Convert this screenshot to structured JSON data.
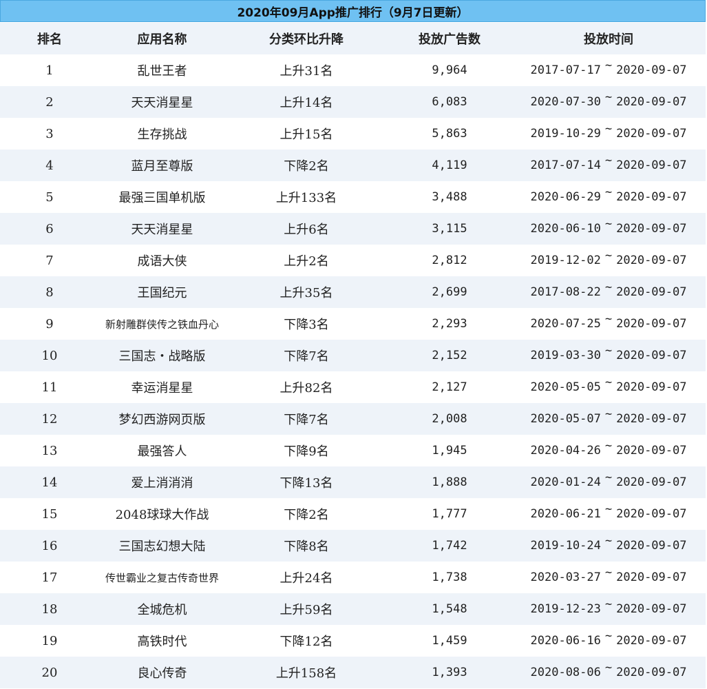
{
  "title": "2020年09月App推广排行（9月7日更新）",
  "columns": [
    "排名",
    "应用名称",
    "分类环比升降",
    "投放广告数",
    "投放时间"
  ],
  "time_separator": "~",
  "rows": [
    {
      "rank": "1",
      "name": "乱世王者",
      "change": "上升31名",
      "count": "9,964",
      "start": "2017-07-17",
      "end": "2020-09-07"
    },
    {
      "rank": "2",
      "name": "天天消星星",
      "change": "上升14名",
      "count": "6,083",
      "start": "2020-07-30",
      "end": "2020-09-07"
    },
    {
      "rank": "3",
      "name": "生存挑战",
      "change": "上升15名",
      "count": "5,863",
      "start": "2019-10-29",
      "end": "2020-09-07"
    },
    {
      "rank": "4",
      "name": "蓝月至尊版",
      "change": "下降2名",
      "count": "4,119",
      "start": "2017-07-14",
      "end": "2020-09-07"
    },
    {
      "rank": "5",
      "name": "最强三国单机版",
      "change": "上升133名",
      "count": "3,488",
      "start": "2020-06-29",
      "end": "2020-09-07"
    },
    {
      "rank": "6",
      "name": "天天消星星",
      "change": "上升6名",
      "count": "3,115",
      "start": "2020-06-10",
      "end": "2020-09-07"
    },
    {
      "rank": "7",
      "name": "成语大侠",
      "change": "上升2名",
      "count": "2,812",
      "start": "2019-12-02",
      "end": "2020-09-07"
    },
    {
      "rank": "8",
      "name": "王国纪元",
      "change": "上升35名",
      "count": "2,699",
      "start": "2017-08-22",
      "end": "2020-09-07"
    },
    {
      "rank": "9",
      "name": "新射雕群侠传之铁血丹心",
      "change": "下降3名",
      "count": "2,293",
      "start": "2020-07-25",
      "end": "2020-09-07"
    },
    {
      "rank": "10",
      "name": "三国志・战略版",
      "change": "下降7名",
      "count": "2,152",
      "start": "2019-03-30",
      "end": "2020-09-07"
    },
    {
      "rank": "11",
      "name": "幸运消星星",
      "change": "上升82名",
      "count": "2,127",
      "start": "2020-05-05",
      "end": "2020-09-07"
    },
    {
      "rank": "12",
      "name": "梦幻西游网页版",
      "change": "下降7名",
      "count": "2,008",
      "start": "2020-05-07",
      "end": "2020-09-07"
    },
    {
      "rank": "13",
      "name": "最强答人",
      "change": "下降9名",
      "count": "1,945",
      "start": "2020-04-26",
      "end": "2020-09-07"
    },
    {
      "rank": "14",
      "name": "爱上消消消",
      "change": "下降13名",
      "count": "1,888",
      "start": "2020-01-24",
      "end": "2020-09-07"
    },
    {
      "rank": "15",
      "name": "2048球球大作战",
      "change": "下降2名",
      "count": "1,777",
      "start": "2020-06-21",
      "end": "2020-09-07"
    },
    {
      "rank": "16",
      "name": "三国志幻想大陆",
      "change": "下降8名",
      "count": "1,742",
      "start": "2019-10-24",
      "end": "2020-09-07"
    },
    {
      "rank": "17",
      "name": "传世霸业之复古传奇世界",
      "change": "上升24名",
      "count": "1,738",
      "start": "2020-03-27",
      "end": "2020-09-07"
    },
    {
      "rank": "18",
      "name": "全城危机",
      "change": "上升59名",
      "count": "1,548",
      "start": "2019-12-23",
      "end": "2020-09-07"
    },
    {
      "rank": "19",
      "name": "高铁时代",
      "change": "下降12名",
      "count": "1,459",
      "start": "2020-06-16",
      "end": "2020-09-07"
    },
    {
      "rank": "20",
      "name": "良心传奇",
      "change": "上升158名",
      "count": "1,393",
      "start": "2020-08-06",
      "end": "2020-09-07"
    }
  ]
}
